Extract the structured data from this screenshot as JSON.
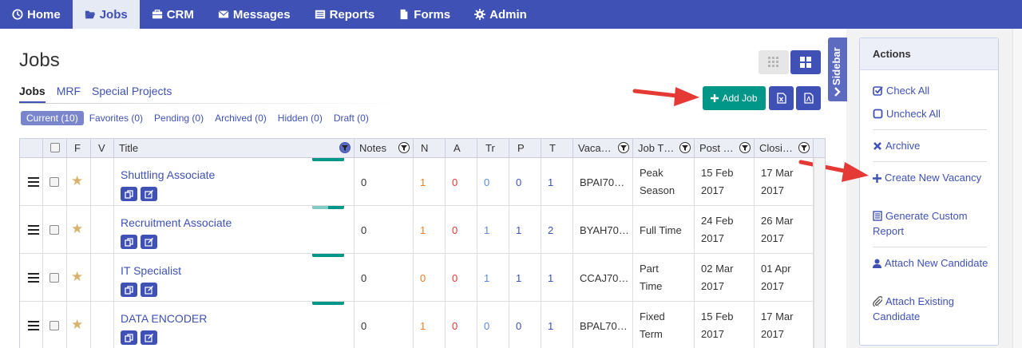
{
  "nav": {
    "items": [
      {
        "label": "Home",
        "icon": "home-icon"
      },
      {
        "label": "Jobs",
        "icon": "folder-open-icon",
        "active": true
      },
      {
        "label": "CRM",
        "icon": "briefcase-icon"
      },
      {
        "label": "Messages",
        "icon": "envelope-icon"
      },
      {
        "label": "Reports",
        "icon": "list-icon"
      },
      {
        "label": "Forms",
        "icon": "file-icon"
      },
      {
        "label": "Admin",
        "icon": "gear-icon"
      }
    ]
  },
  "page": {
    "title": "Jobs"
  },
  "subtabs": [
    "Jobs",
    "MRF",
    "Special Projects"
  ],
  "filters": [
    "Current (10)",
    "Favorites (0)",
    "Pending (0)",
    "Archived (0)",
    "Hidden (0)",
    "Draft (0)"
  ],
  "toolbar": {
    "add_job": "Add Job",
    "sidebar_label": "Sidebar"
  },
  "table": {
    "headers": {
      "f": "F",
      "v": "V",
      "title": "Title",
      "notes": "Notes",
      "n": "N",
      "a": "A",
      "tr": "Tr",
      "p": "P",
      "t": "T",
      "vacancy": "Vaca…",
      "job_type": "Job T…",
      "post": "Post …",
      "closing": "Closi…"
    },
    "rows": [
      {
        "title": "Shuttling Associate",
        "notes": "0",
        "n": "1",
        "a": "0",
        "tr": "0",
        "p": "0",
        "t": "1",
        "vacancy": "BPAI70…",
        "job_type_1": "Peak",
        "job_type_2": "Season",
        "post_1": "15 Feb",
        "post_2": "2017",
        "close_1": "17 Mar",
        "close_2": "2017"
      },
      {
        "title": "Recruitment Associate",
        "notes": "0",
        "n": "1",
        "a": "0",
        "tr": "1",
        "p": "1",
        "t": "2",
        "vacancy": "BYAH70…",
        "job_type_1": "Full Time",
        "job_type_2": "",
        "post_1": "24 Feb",
        "post_2": "2017",
        "close_1": "26 Mar",
        "close_2": "2017"
      },
      {
        "title": "IT Specialist",
        "notes": "0",
        "n": "0",
        "a": "0",
        "tr": "1",
        "p": "1",
        "t": "1",
        "vacancy": "CCAJ70…",
        "job_type_1": "Part",
        "job_type_2": "Time",
        "post_1": "02 Mar",
        "post_2": "2017",
        "close_1": "01 Apr",
        "close_2": "2017"
      },
      {
        "title": "DATA ENCODER",
        "notes": "0",
        "n": "1",
        "a": "0",
        "tr": "0",
        "p": "0",
        "t": "1",
        "vacancy": "BPAL70…",
        "job_type_1": "Fixed",
        "job_type_2": "Term",
        "post_1": "15 Feb",
        "post_2": "2017",
        "close_1": "17 Mar",
        "close_2": "2017"
      }
    ]
  },
  "actions": {
    "title": "Actions",
    "check_all": "Check All",
    "uncheck_all": "Uncheck All",
    "archive": "Archive",
    "create_vacancy": "Create New Vacancy",
    "custom_report": "Generate Custom Report",
    "attach_new": "Attach New Candidate",
    "attach_existing": "Attach Existing Candidate"
  },
  "colors": {
    "nav": "#3f51b5",
    "add_button": "#009688",
    "annotation_arrow": "#e53935"
  }
}
